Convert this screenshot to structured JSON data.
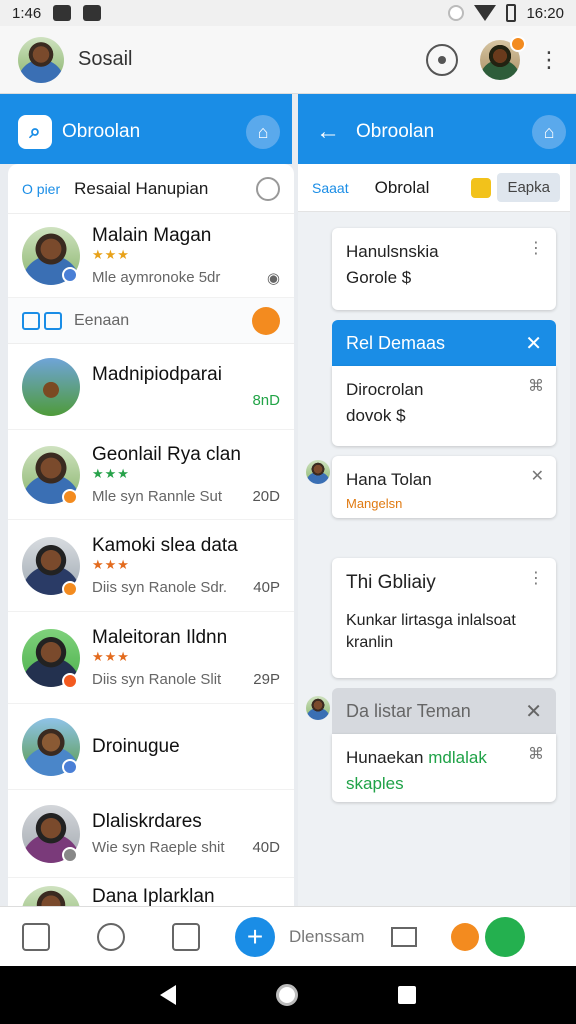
{
  "status_bar": {
    "time_left": "1:46",
    "time_right": "16:20"
  },
  "app": {
    "title": "Sosail"
  },
  "left_header": {
    "title": "Obroolan"
  },
  "right_header": {
    "title": "Obroolan"
  },
  "filter": {
    "tag": "O pier",
    "title": "Resaial Hanupian"
  },
  "section": {
    "label": "Eenaan"
  },
  "chats": [
    {
      "name": "Malain Magan",
      "stars": "★★★",
      "sub": "Mle aymronoke 5dr",
      "time": ""
    },
    {
      "name": "Madnipiodparai",
      "stars": "",
      "sub": "",
      "time": "8nD"
    },
    {
      "name": "Geonlail Rya clan",
      "stars": "★★★",
      "sub": "Mle syn Rannle Sut",
      "time": "20D"
    },
    {
      "name": "Kamoki slea data",
      "stars": "★★★",
      "sub": "Diis syn Ranole Sdr.",
      "time": "40P"
    },
    {
      "name": "Maleitoran Ildnn",
      "stars": "★★★",
      "sub": "Diis syn Ranole Slit",
      "time": "29P"
    },
    {
      "name": "Droinugue",
      "stars": "",
      "sub": "",
      "time": ""
    },
    {
      "name": "Dlaliskrdares",
      "stars": "",
      "sub": "Wie syn Raeple shit",
      "time": "40D"
    },
    {
      "name": "Dana Iplarklan",
      "stars": "",
      "sub": "",
      "time": ""
    }
  ],
  "tabs": {
    "a": "Saaat",
    "b": "Obrolal",
    "c": "Eapka"
  },
  "cards": {
    "c1": {
      "line1": "Hanulsnskia",
      "line2": "Gorole $"
    },
    "c2_head": "Rel Demaas",
    "c2": {
      "line1": "Dirocrolan",
      "line2": "dovok $"
    },
    "c3": {
      "line1": "Hana Tolan",
      "line2": "Mangelsn"
    },
    "c4": {
      "line1": "Thi Gbliaiy",
      "line2": "Kunkar lirtasga inlalsoat",
      "line3": "kranlin"
    },
    "c5_head": "Da listar Teman",
    "c5": {
      "line1": "Hunaekan",
      "line1b": "mdlalak",
      "line2": "skaples"
    }
  },
  "bottom_nav": {
    "label": "Dlenssam"
  }
}
